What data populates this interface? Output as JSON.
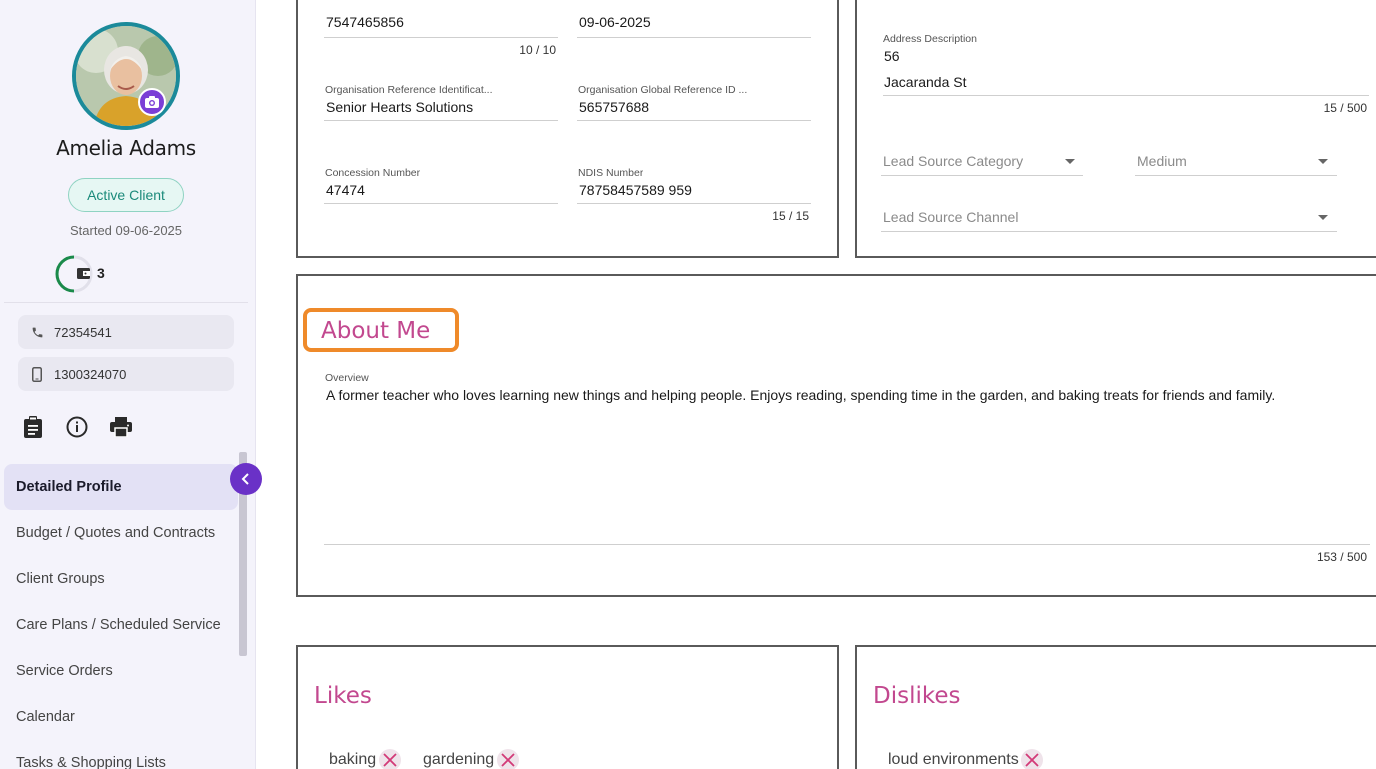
{
  "client": {
    "name": "Amelia Adams",
    "status": "Active Client",
    "started": "Started 09-06-2025",
    "count": "3",
    "phone": "72354541",
    "mobile": "1300324070"
  },
  "nav": {
    "items": [
      {
        "label": "Detailed Profile",
        "active": true
      },
      {
        "label": "Budget / Quotes and Contracts"
      },
      {
        "label": "Client Groups"
      },
      {
        "label": "Care Plans / Scheduled Service"
      },
      {
        "label": "Service Orders"
      },
      {
        "label": "Calendar"
      },
      {
        "label": "Tasks & Shopping Lists"
      }
    ]
  },
  "identifiers": {
    "top_left_value": "7547465856",
    "top_left_counter": "10 / 10",
    "top_right_value": "09-06-2025",
    "org_ref_label": "Organisation Reference Identificat...",
    "org_ref_value": "Senior Hearts Solutions",
    "org_global_label": "Organisation Global Reference ID ...",
    "org_global_value": "565757688",
    "concession_label": "Concession Number",
    "concession_value": "47474",
    "ndis_label": "NDIS Number",
    "ndis_value": "78758457589 959",
    "ndis_counter": "15 / 15"
  },
  "address": {
    "label": "Address Description",
    "line1": "56",
    "line2": "Jacaranda St",
    "counter": "15 / 500",
    "lead_source_category": "Lead Source Category",
    "medium": "Medium",
    "lead_source_channel": "Lead Source Channel"
  },
  "about": {
    "title": "About Me",
    "overview_label": "Overview",
    "overview_text": "A former teacher who loves learning new things and helping people. Enjoys reading, spending time in the garden, and baking treats for friends and family.",
    "counter": "153 / 500"
  },
  "likes": {
    "title": "Likes",
    "chips": [
      "baking",
      "gardening"
    ]
  },
  "dislikes": {
    "title": "Dislikes",
    "chips": [
      "loud environments"
    ]
  },
  "colors": {
    "accent_purple": "#6a31c7",
    "section_title_pink": "#c2488f",
    "highlight_orange": "#ef8a2a",
    "status_green": "#1b8a7a"
  },
  "icons": {
    "phone": "phone-icon",
    "mobile": "mobile-icon",
    "clipboard": "clipboard-icon",
    "info": "info-icon",
    "print": "print-icon",
    "camera": "camera-icon",
    "collapse": "chevron-left-icon",
    "remove": "close-icon"
  }
}
